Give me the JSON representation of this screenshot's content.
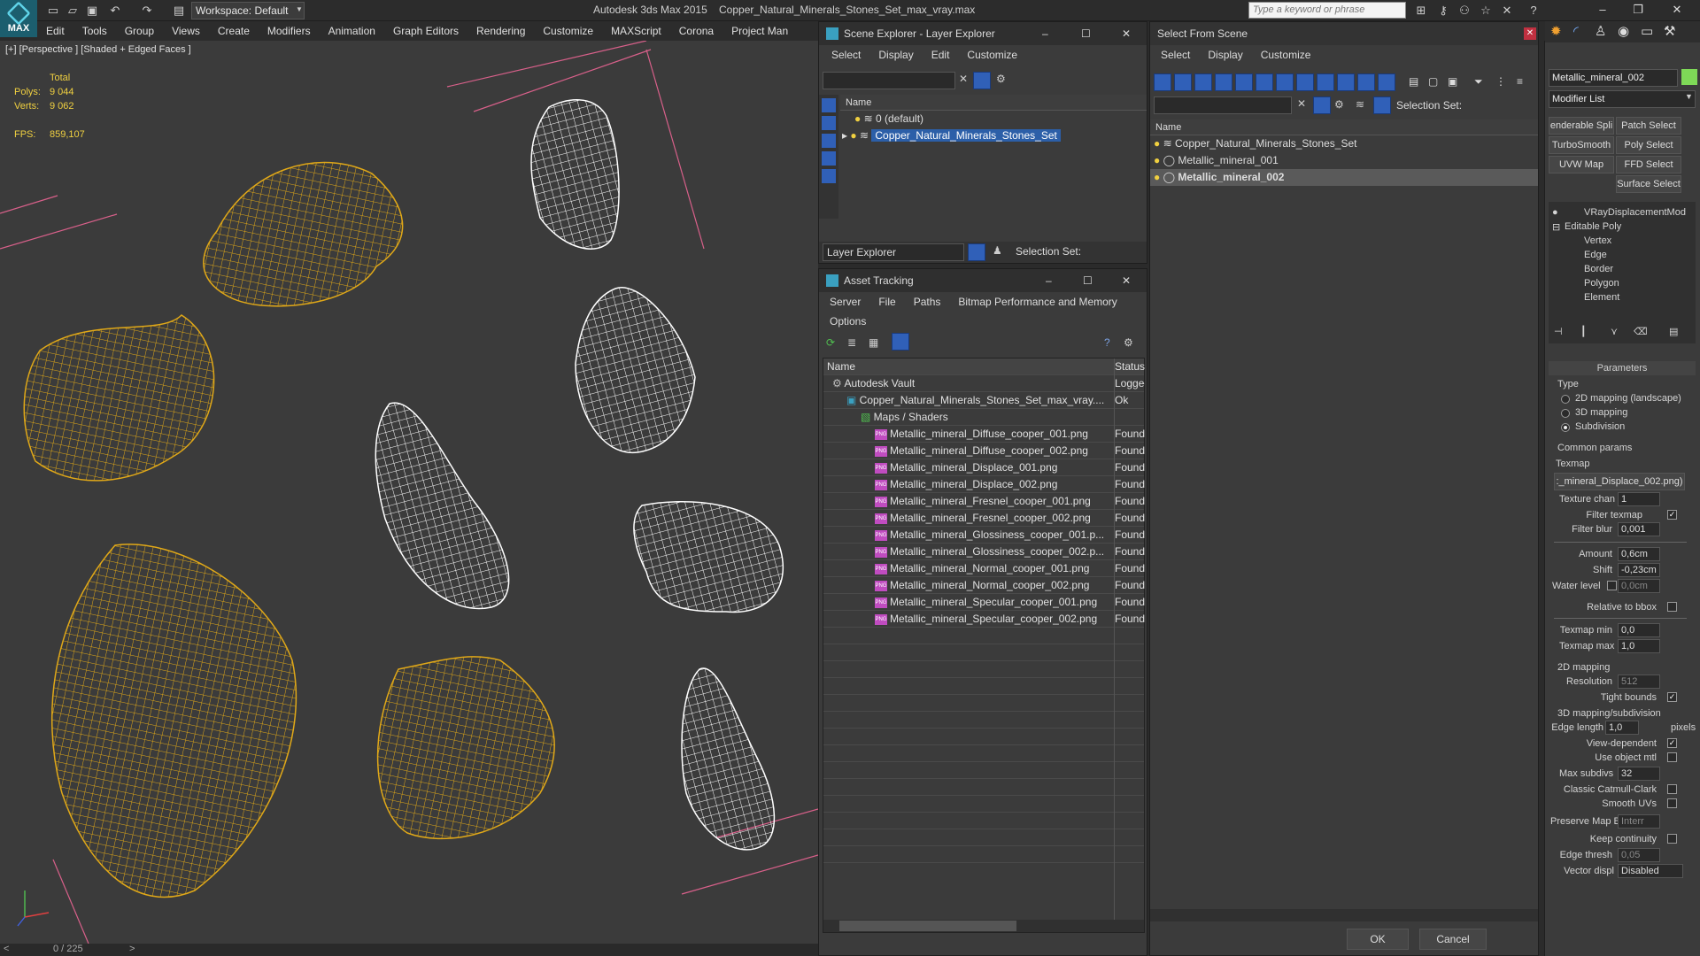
{
  "app": {
    "name": "Autodesk 3ds Max 2015",
    "file": "Copper_Natural_Minerals_Stones_Set_max_vray.max",
    "workspace": "Workspace: Default",
    "search_placeholder": "Type a keyword or phrase",
    "logo": "MAX"
  },
  "menu": [
    "Edit",
    "Tools",
    "Group",
    "Views",
    "Create",
    "Modifiers",
    "Animation",
    "Graph Editors",
    "Rendering",
    "Customize",
    "MAXScript",
    "Corona",
    "Project Man"
  ],
  "viewport": {
    "label": "[+] [Perspective ] [Shaded + Edged Faces ]",
    "total": "Total",
    "polys_label": "Polys:",
    "polys": "9 044",
    "verts_label": "Verts:",
    "verts": "9 062",
    "fps_label": "FPS:",
    "fps": "859,107"
  },
  "timeline": {
    "value": "0 / 225",
    "prev": "<",
    "next": ">"
  },
  "scene_explorer": {
    "title": "Scene Explorer - Layer Explorer",
    "menu": [
      "Select",
      "Display",
      "Edit",
      "Customize"
    ],
    "col_name": "Name",
    "rows": [
      "0 (default)",
      "Copper_Natural_Minerals_Stones_Set"
    ],
    "footer_label": "Layer Explorer",
    "selection_set": "Selection Set:"
  },
  "asset": {
    "title": "Asset Tracking",
    "menu": [
      "Server",
      "File",
      "Paths",
      "Bitmap Performance and Memory",
      "Options"
    ],
    "col_name": "Name",
    "col_status": "Status",
    "rows": [
      {
        "name": "Autodesk Vault",
        "status": "Logged",
        "indent": 1
      },
      {
        "name": "Copper_Natural_Minerals_Stones_Set_max_vray....",
        "status": "Ok",
        "indent": 2
      },
      {
        "name": "Maps / Shaders",
        "status": "",
        "indent": 3
      },
      {
        "name": "Metallic_mineral_Diffuse_cooper_001.png",
        "status": "Found",
        "indent": 4
      },
      {
        "name": "Metallic_mineral_Diffuse_cooper_002.png",
        "status": "Found",
        "indent": 4
      },
      {
        "name": "Metallic_mineral_Displace_001.png",
        "status": "Found",
        "indent": 4
      },
      {
        "name": "Metallic_mineral_Displace_002.png",
        "status": "Found",
        "indent": 4
      },
      {
        "name": "Metallic_mineral_Fresnel_cooper_001.png",
        "status": "Found",
        "indent": 4
      },
      {
        "name": "Metallic_mineral_Fresnel_cooper_002.png",
        "status": "Found",
        "indent": 4
      },
      {
        "name": "Metallic_mineral_Glossiness_cooper_001.p...",
        "status": "Found",
        "indent": 4
      },
      {
        "name": "Metallic_mineral_Glossiness_cooper_002.p...",
        "status": "Found",
        "indent": 4
      },
      {
        "name": "Metallic_mineral_Normal_cooper_001.png",
        "status": "Found",
        "indent": 4
      },
      {
        "name": "Metallic_mineral_Normal_cooper_002.png",
        "status": "Found",
        "indent": 4
      },
      {
        "name": "Metallic_mineral_Specular_cooper_001.png",
        "status": "Found",
        "indent": 4
      },
      {
        "name": "Metallic_mineral_Specular_cooper_002.png",
        "status": "Found",
        "indent": 4
      }
    ]
  },
  "sfs": {
    "title": "Select From Scene",
    "menu": [
      "Select",
      "Display",
      "Customize"
    ],
    "selection_set": "Selection Set:",
    "col_name": "Name",
    "rows": [
      "Copper_Natural_Minerals_Stones_Set",
      "Metallic_mineral_001",
      "Metallic_mineral_002"
    ],
    "ok": "OK",
    "cancel": "Cancel"
  },
  "cmd": {
    "object_name": "Metallic_mineral_002",
    "modifier_list": "Modifier List",
    "buttons": [
      "enderable Spli",
      "Patch Select",
      "TurboSmooth",
      "Poly Select",
      "UVW Map",
      "FFD Select",
      "Surface Select"
    ],
    "stack": [
      "VRayDisplacementMod",
      "Editable Poly",
      "Vertex",
      "Edge",
      "Border",
      "Polygon",
      "Element"
    ],
    "rollout": "Parameters",
    "type_label": "Type",
    "types": [
      "2D mapping (landscape)",
      "3D mapping",
      "Subdivision"
    ],
    "common": "Common params",
    "texmap": "Texmap",
    "texmap_value": ":_mineral_Displace_002.png)",
    "texture_chan": "Texture chan",
    "texture_chan_v": "1",
    "filter_texmap": "Filter texmap",
    "filter_blur": "Filter blur",
    "filter_blur_v": "0,001",
    "amount": "Amount",
    "amount_v": "0,6cm",
    "shift": "Shift",
    "shift_v": "-0,23cm",
    "water": "Water level",
    "water_v": "0,0cm",
    "relative": "Relative to bbox",
    "tmin": "Texmap min",
    "tmin_v": "0,0",
    "tmax": "Texmap max",
    "tmax_v": "1,0",
    "map2d": "2D mapping",
    "resolution": "Resolution",
    "resolution_v": "512",
    "tight": "Tight bounds",
    "map3d": "3D mapping/subdivision",
    "edge_len": "Edge length",
    "edge_len_v": "1,0",
    "pixels": "pixels",
    "view_dep": "View-dependent",
    "use_obj": "Use object mtl",
    "max_subdivs": "Max subdivs",
    "max_subdivs_v": "32",
    "catmull": "Classic Catmull-Clark",
    "smooth_uvs": "Smooth UVs",
    "preserve": "Preserve Map Bnd",
    "preserve_v": "Interr",
    "keep": "Keep continuity",
    "edge_thresh": "Edge thresh",
    "edge_thresh_v": "0,05",
    "vector": "Vector displ",
    "vector_v": "Disabled"
  },
  "colors": {
    "wire_gold": "#e0a818",
    "wire_white": "#ffffff",
    "viewport_bg": "#3b3b3b",
    "select_blue": "#2c5fa8",
    "swatch": "#7ed957"
  }
}
